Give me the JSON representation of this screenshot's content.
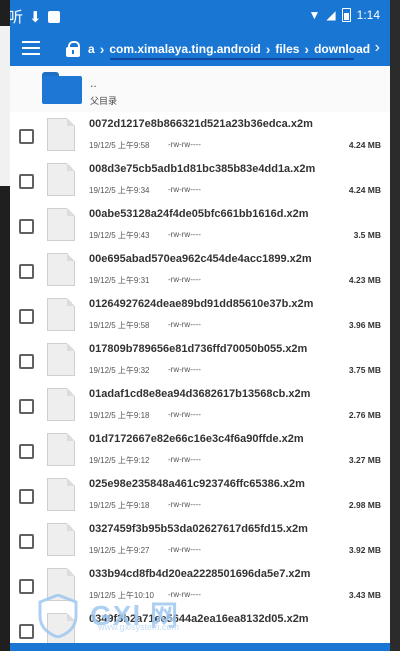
{
  "status_bar": {
    "left_icons": [
      "listen-app-icon",
      "download-icon",
      "notification-square-icon"
    ],
    "listen_label": "听",
    "time": "1:14",
    "right_icons": [
      "wifi-icon",
      "signal-icon",
      "battery-icon"
    ]
  },
  "app_bar": {
    "menu_icon": "hamburger-menu-icon",
    "lock_icon": "lock-icon",
    "breadcrumbs": [
      "a",
      "com.ximalaya.ting.android",
      "files",
      "download"
    ],
    "more_icon": "chevron-right-icon"
  },
  "parent_folder": {
    "dots": "..",
    "label": "父目录"
  },
  "files": [
    {
      "name": "0072d1217e8b866321d521a23b36edca.x2m",
      "date": "19/12/5 上午9:58",
      "perm": "-rw-rw----",
      "size": "4.24 MB"
    },
    {
      "name": "008d3e75cb5adb1d81bc385b83e4dd1a.x2m",
      "date": "19/12/5 上午9:34",
      "perm": "-rw-rw----",
      "size": "4.24 MB"
    },
    {
      "name": "00abe53128a24f4de05bfc661bb1616d.x2m",
      "date": "19/12/5 上午9:43",
      "perm": "-rw-rw----",
      "size": "3.5 MB"
    },
    {
      "name": "00e695abad570ea962c454de4acc1899.x2m",
      "date": "19/12/5 上午9:31",
      "perm": "-rw-rw----",
      "size": "4.23 MB"
    },
    {
      "name": "01264927624deae89bd91dd85610e37b.x2m",
      "date": "19/12/5 上午9:58",
      "perm": "-rw-rw----",
      "size": "3.96 MB"
    },
    {
      "name": "017809b789656e81d736ffd70050b055.x2m",
      "date": "19/12/5 上午9:32",
      "perm": "-rw-rw----",
      "size": "3.75 MB"
    },
    {
      "name": "01adaf1cd8e8ea94d3682617b13568cb.x2m",
      "date": "19/12/5 上午9:18",
      "perm": "-rw-rw----",
      "size": "2.76 MB"
    },
    {
      "name": "01d7172667e82e66c16e3c4f6a90ffde.x2m",
      "date": "19/12/5 上午9:12",
      "perm": "-rw-rw----",
      "size": "3.27 MB"
    },
    {
      "name": "025e98e235848a461c923746ffc65386.x2m",
      "date": "19/12/5 上午9:18",
      "perm": "-rw-rw----",
      "size": "2.98 MB"
    },
    {
      "name": "0327459f3b95b53da02627617d65fd15.x2m",
      "date": "19/12/5 上午9:27",
      "perm": "-rw-rw----",
      "size": "3.92 MB"
    },
    {
      "name": "033b94cd8fb4d20ea2228501696da5e7.x2m",
      "date": "19/12/5 上午10:10",
      "perm": "-rw-rw----",
      "size": "3.43 MB"
    },
    {
      "name": "0349f3b2a71ee5644a2ea16ea8132d05.x2m",
      "date": "",
      "perm": "",
      "size": ""
    }
  ],
  "watermark": {
    "brand": "GXl 网",
    "url": "www.gxlsystem.com"
  },
  "colors": {
    "primary": "#1976d2",
    "folder": "#1e77d4",
    "text_dark": "#333333"
  }
}
